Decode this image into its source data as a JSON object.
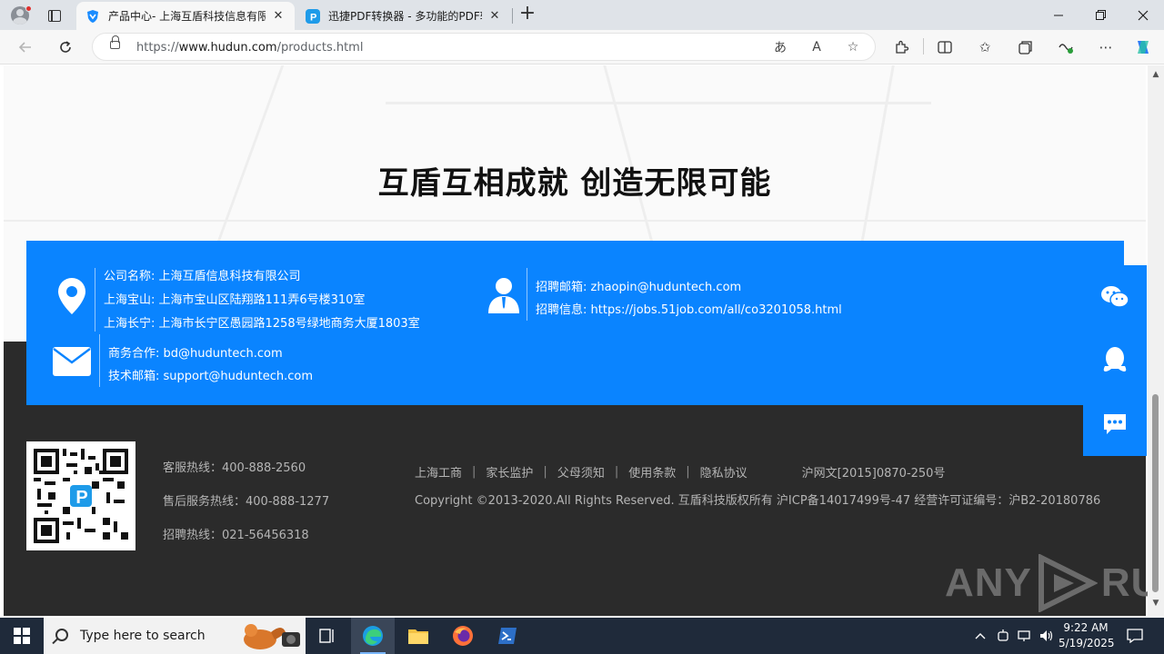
{
  "browser": {
    "tabs": [
      {
        "title": "产品中心- 上海互盾科技信息有限",
        "active": true
      },
      {
        "title": "迅捷PDF转换器 - 多功能的PDF转",
        "active": false
      }
    ],
    "url": {
      "prefix": "https://",
      "domain": "www.hudun.com",
      "path": "/products.html"
    }
  },
  "page": {
    "slogan": "互盾互相成就 创造无限可能",
    "contact": {
      "company": "公司名称: 上海互盾信息科技有限公司",
      "baoshan": "上海宝山: 上海市宝山区陆翔路111弄6号楼310室",
      "changning": "上海长宁: 上海市长宁区愚园路1258号绿地商务大厦1803室",
      "hr_email": "招聘邮箱: zhaopin@huduntech.com",
      "hr_info": "招聘信息: https://jobs.51job.com/all/co3201058.html",
      "biz_email": "商务合作: bd@huduntech.com",
      "tech_email": "技术邮箱: support@huduntech.com"
    },
    "footer": {
      "hotlines": [
        "客服热线：400-888-2560",
        "售后服务热线：400-888-1277",
        "招聘热线：021-56456318"
      ],
      "links": [
        "上海工商",
        "家长监护",
        "父母须知",
        "使用条款",
        "隐私协议"
      ],
      "link_sep": "|",
      "icp_wen": "沪网文[2015]0870-250号",
      "copyright": "Copyright ©2013-2020.All Rights Reserved. 互盾科技版权所有 沪ICP备14017499号-47   经营许可证编号：沪B2-20180786"
    },
    "watermark": {
      "left": "ANY",
      "right": "RUN"
    }
  },
  "taskbar": {
    "search_placeholder": "Type here to search",
    "time": "9:22 AM",
    "date": "5/19/2025"
  },
  "colors": {
    "brand_blue": "#0a84ff",
    "footer_bg": "#2b2b2b",
    "taskbar": "#1f2a3a"
  }
}
